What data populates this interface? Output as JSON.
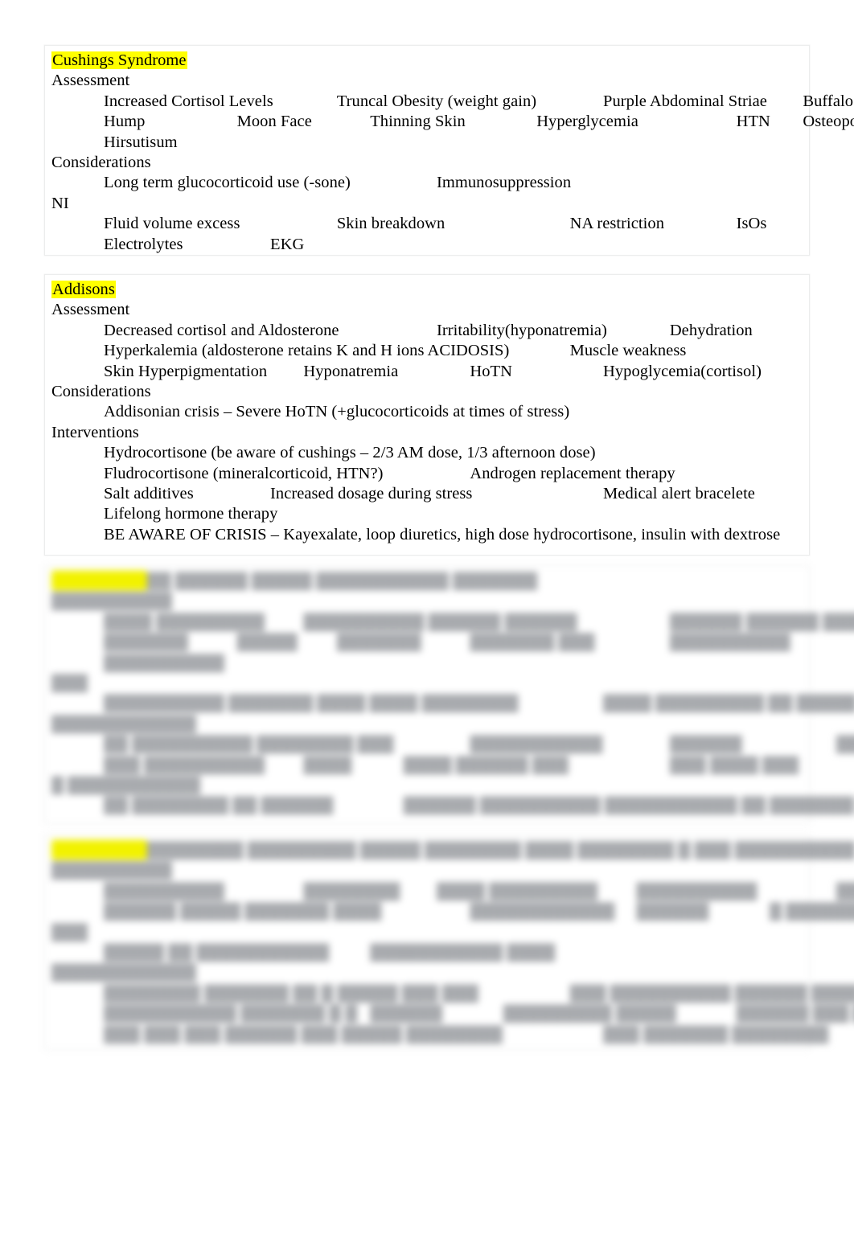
{
  "document": {
    "type": "study-notes",
    "page_background": "#ffffff",
    "highlight_color": "#ffff00",
    "text_color": "#000000"
  },
  "blocks": [
    {
      "id": "cushings",
      "title": "Cushings Syndrome",
      "title_highlighted": true,
      "legible": true,
      "sections": [
        {
          "heading": "Assessment",
          "lines": [
            "Increased Cortisol Levels\t\tTruncal Obesity (weight gain)\t\tPurple Abdominal Striae\t\tBuffalo",
            "Hump\t\t\tMoon Face\t\tThinning Skin\t\t\tHyperglycemia\t\t\tHTN\tOsteoporosis",
            "Hirsutisum"
          ]
        },
        {
          "heading": "Considerations",
          "lines": [
            "Long term glucocorticoid use (-sone)\t\t\tImmunosuppression"
          ]
        },
        {
          "heading": "NI",
          "lines": [
            "Fluid volume excess\t\t\tSkin breakdown\t\t\t\tNA restriction\t\t\tIsOs",
            "Electrolytes\t\t\tEKG"
          ]
        }
      ]
    },
    {
      "id": "addisons",
      "title": "Addisons",
      "title_highlighted": true,
      "legible": true,
      "sections": [
        {
          "heading": "Assessment",
          "lines": [
            "Decreased cortisol and Aldosterone\t\t\tIrritability(hyponatremia)\t\tDehydration",
            "Hyperkalemia (aldosterone retains K and H ions ACIDOSIS)\t\tMuscle weakness",
            "Skin Hyperpigmentation\t\tHyponatremia\t\t\tHoTN\t\t\tHypoglycemia(cortisol)"
          ]
        },
        {
          "heading": "Considerations",
          "lines": [
            "Addisonian crisis – Severe HoTN (+glucocorticoids at times of stress)"
          ]
        },
        {
          "heading": "Interventions",
          "lines": [
            "Hydrocortisone (be aware of cushings – 2/3 AM dose, 1/3 afternoon dose)",
            "Fludrocortisone (mineralcorticoid, HTN?)\t\t\tAndrogen replacement therapy",
            "Salt additives\t\t\tIncreased dosage during stress\t\t\t\tMedical alert bracelete",
            "Lifelong hormone therapy",
            "BE AWARE OF CRISIS – Kayexalate, loop diuretics, high dose hydrocortisone, insulin with dextrose"
          ]
        }
      ]
    },
    {
      "id": "block-three",
      "title": "████████",
      "title_highlighted": true,
      "legible": false,
      "note": "text is blurred and illegible in the screenshot",
      "title_tail": "▓▓ ▓▓▓▓▓▓ ▓▓▓▓▓ ▓▓▓▓▓▓▓▓▓▓▓ ▓▓▓▓▓▓▓",
      "sections": [
        {
          "heading": "▓▓▓▓▓▓▓▓▓▓",
          "lines": [
            "▓▓▓▓ ▓▓▓▓▓▓▓▓▓\t\t▓▓▓▓▓▓▓▓▓▓ ▓▓▓▓▓▓ ▓▓▓▓▓▓\t\t\t▓▓▓▓▓▓ ▓▓▓▓▓▓ ▓▓▓▓ ▓▓▓▓ ▓▓▓",
            "▓▓▓▓▓▓▓\t\t▓▓▓▓▓\t\t▓▓▓▓▓▓▓\t\t▓▓▓▓▓▓▓ ▓▓▓\t\t\t▓▓▓▓▓▓▓▓▓▓\t\t\t▓▓▓▓",
            "▓▓▓▓▓▓▓▓▓▓"
          ]
        },
        {
          "heading": "▓▓▓",
          "lines": [
            "▓▓▓▓▓▓▓▓▓▓ ▓▓▓▓▓▓▓ ▓▓▓▓ ▓▓▓▓ ▓▓▓▓▓▓▓▓\t\t\t▓▓▓▓ ▓▓▓▓▓▓▓▓▓ ▓▓ ▓▓▓▓▓ ▓▓▓▓▓▓▓▓ ▓▓▓▓ ▓▓▓▓▓▓ ▓▓▓▓▓ ▓▓▓▓▓▓▓▓▓"
          ]
        },
        {
          "heading": "▓▓▓▓▓▓▓▓▓▓▓▓",
          "lines": [
            "▓▓ ▓▓▓▓▓▓▓▓▓▓ ▓▓▓▓▓▓▓▓ ▓▓▓\t\t\t▓▓▓▓▓▓▓▓▓▓▓\t\t▓▓▓▓▓▓\t\t\t▓▓▓▓ ▓▓▓▓▓▓▓▓",
            "▓▓▓ ▓▓▓▓▓▓▓▓▓▓\t\t▓▓▓▓\t\t▓▓▓▓ ▓▓▓▓▓▓ ▓▓▓\t\t\t▓▓▓ ▓▓▓▓ ▓▓▓"
          ]
        },
        {
          "heading": "▓ ▓▓▓▓▓▓▓▓▓▓▓",
          "lines": [
            "▓▓ ▓▓▓▓▓▓▓▓ ▓▓ ▓▓▓▓▓▓\t\t\t▓▓▓▓▓▓ ▓▓▓▓▓▓▓▓▓▓ ▓▓▓▓▓▓▓▓▓▓▓ ▓▓ ▓▓▓▓▓▓▓ ▓▓▓▓▓▓▓▓▓▓ ▓▓ ▓▓▓▓▓▓▓▓"
          ]
        }
      ]
    },
    {
      "id": "block-four",
      "title": "████████",
      "title_highlighted": true,
      "legible": false,
      "note": "text is blurred and illegible in the screenshot",
      "title_tail": "▓▓▓▓▓▓▓▓ ▓▓▓▓▓▓▓▓▓ ▓▓▓▓▓ ▓▓▓▓▓▓▓▓ ▓▓▓▓ ▓▓▓▓▓▓▓▓ ▓ ▓▓▓ ▓▓▓▓▓▓▓▓▓▓",
      "sections": [
        {
          "heading": "▓▓▓▓▓▓▓▓▓▓",
          "lines": [
            "▓▓▓▓▓▓▓▓▓▓\t\t\t▓▓▓▓▓▓▓▓\t\t▓▓▓▓ ▓▓▓▓▓▓▓▓▓\t\t▓▓▓▓▓▓▓▓▓▓\t\t\t▓▓▓▓ ▓▓▓▓▓▓▓ ▓▓▓▓▓▓",
            "▓▓▓▓▓▓ ▓▓▓▓▓ ▓▓▓▓▓▓▓ ▓▓▓▓\t\t\t▓▓▓▓▓▓▓▓▓▓▓▓\t▓▓▓▓▓▓\t\t▓ ▓▓▓▓▓▓▓▓▓▓ ▓▓▓▓▓\t\t▓▓▓▓ ▓▓▓▓▓▓▓▓"
          ]
        },
        {
          "heading": "▓▓▓",
          "lines": [
            "▓▓▓▓▓ ▓▓ ▓▓▓▓▓▓▓▓▓▓▓\t\t▓▓▓▓▓▓▓▓▓▓▓ ▓▓▓▓"
          ]
        },
        {
          "heading": "▓▓▓▓▓▓▓▓▓▓▓▓",
          "lines": [
            "▓▓▓▓▓▓▓▓ ▓▓▓▓▓▓▓ ▓▓ ▓ ▓▓▓▓▓ ▓▓▓ ▓▓▓\t\t\t▓▓▓ ▓▓▓▓▓▓▓▓▓▓ ▓▓▓▓▓▓ ▓▓▓▓ ▓▓ ▓ ▓▓▓▓▓▓ ▓▓▓▓▓▓▓▓ ▓ ▓▓▓▓ ▓▓",
            "▓▓▓▓▓▓▓▓▓▓▓ ▓▓▓▓▓▓▓ ▓ ▓\t▓▓▓▓▓▓\t\t▓▓▓▓▓▓▓▓▓ ▓▓▓▓▓\t\t▓▓▓▓▓▓ ▓▓▓ ▓▓▓▓▓\t\t\t▓▓▓▓ ▓▓▓▓▓▓▓",
            "▓▓▓ ▓▓▓ ▓▓▓ ▓▓▓▓▓▓ ▓▓▓ ▓▓▓▓▓ ▓▓▓▓▓▓▓▓\t\t\t▓▓▓ ▓▓▓▓▓▓▓ ▓▓▓▓▓▓▓▓"
          ]
        }
      ]
    }
  ]
}
